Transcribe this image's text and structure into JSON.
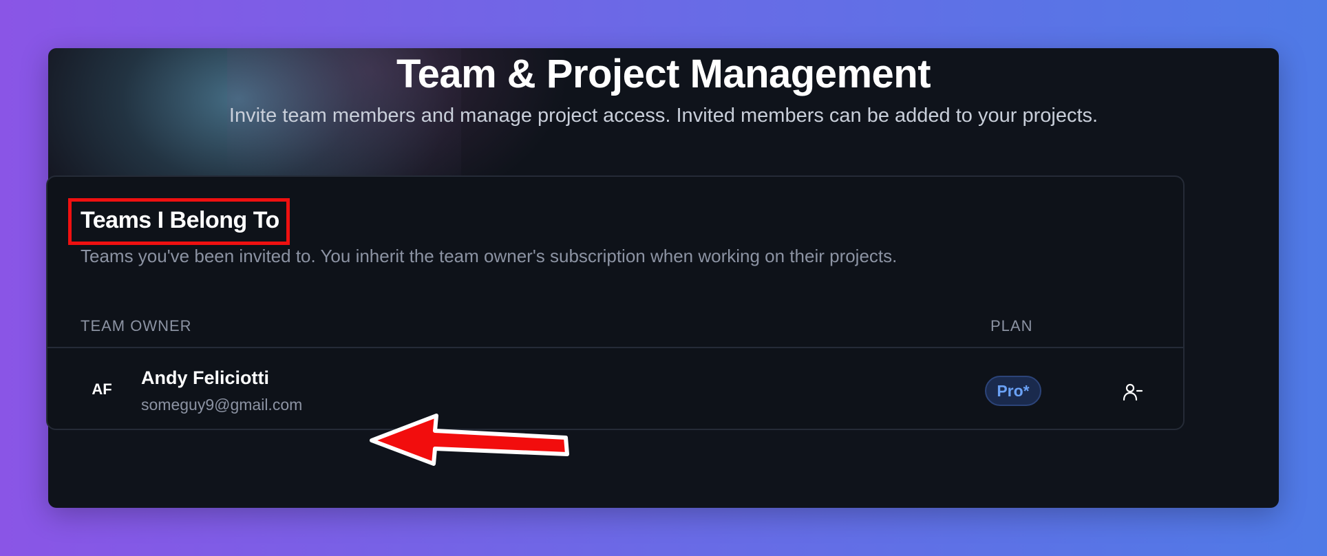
{
  "header": {
    "title": "Team & Project Management",
    "subtitle": "Invite team members and manage project access. Invited members can be added to your projects."
  },
  "section": {
    "title": "Teams I Belong To",
    "description": "Teams you've been invited to. You inherit the team owner's subscription when working on their projects."
  },
  "table": {
    "columns": {
      "owner": "TEAM OWNER",
      "plan": "PLAN"
    },
    "rows": [
      {
        "initials": "AF",
        "name": "Andy Feliciotti",
        "email": "someguy9@gmail.com",
        "plan": "Pro*",
        "action_icon": "user-minus-icon"
      }
    ]
  },
  "colors": {
    "highlight": "#ef1010",
    "plan_badge_text": "#6aa1f5",
    "annotation_arrow": "#f20d0d"
  }
}
